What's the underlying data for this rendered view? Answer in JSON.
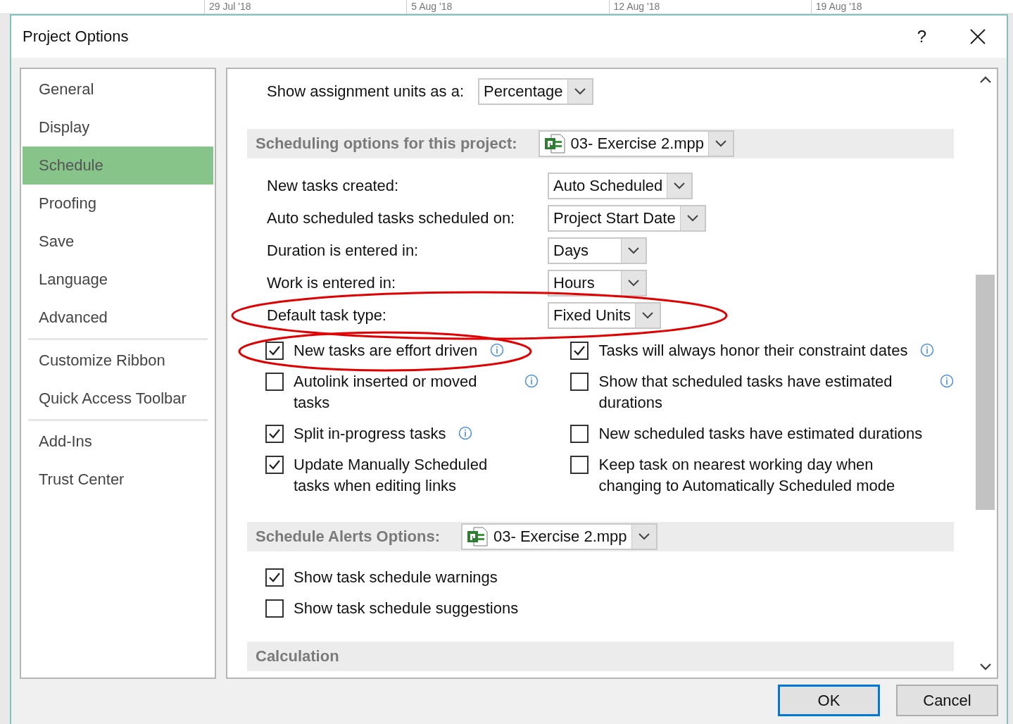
{
  "timeline": {
    "dates": [
      "29 Jul '18",
      "5 Aug '18",
      "12 Aug '18",
      "19 Aug '18"
    ]
  },
  "dialog": {
    "title": "Project Options",
    "help": "?"
  },
  "nav": {
    "groups": [
      [
        {
          "label": "General",
          "selected": false
        },
        {
          "label": "Display",
          "selected": false
        },
        {
          "label": "Schedule",
          "selected": true
        },
        {
          "label": "Proofing",
          "selected": false
        },
        {
          "label": "Save",
          "selected": false
        },
        {
          "label": "Language",
          "selected": false
        },
        {
          "label": "Advanced",
          "selected": false
        }
      ],
      [
        {
          "label": "Customize Ribbon",
          "selected": false
        },
        {
          "label": "Quick Access Toolbar",
          "selected": false
        }
      ],
      [
        {
          "label": "Add-Ins",
          "selected": false
        },
        {
          "label": "Trust Center",
          "selected": false
        }
      ]
    ]
  },
  "assignment_units": {
    "label": "Show assignment units as a:",
    "value": "Percentage"
  },
  "scheduling": {
    "heading": "Scheduling options for this project:",
    "project": "03- Exercise 2.mpp",
    "fields": [
      {
        "label": "New tasks created:",
        "value": "Auto Scheduled",
        "highlighted": false
      },
      {
        "label": "Auto scheduled tasks scheduled on:",
        "value": "Project Start Date",
        "highlighted": false
      },
      {
        "label": "Duration is entered in:",
        "value": "Days",
        "highlighted": false
      },
      {
        "label": "Work is entered in:",
        "value": "Hours",
        "highlighted": false
      },
      {
        "label": "Default task type:",
        "value": "Fixed Units",
        "highlighted": true
      }
    ],
    "options_left": [
      {
        "label": "New tasks are effort driven",
        "checked": true,
        "info": true,
        "highlighted": true
      },
      {
        "label": "Autolink inserted or moved tasks",
        "checked": false,
        "info": true,
        "highlighted": false
      },
      {
        "label": "Split in-progress tasks",
        "checked": true,
        "info": true,
        "highlighted": false
      },
      {
        "label": "Update Manually Scheduled tasks when editing links",
        "checked": true,
        "info": false,
        "highlighted": false
      }
    ],
    "options_right": [
      {
        "label": "Tasks will always honor their constraint dates",
        "checked": true,
        "info": true,
        "highlighted": false
      },
      {
        "label": "Show that scheduled tasks have estimated durations",
        "checked": false,
        "info": true,
        "highlighted": false
      },
      {
        "label": "New scheduled tasks have estimated durations",
        "checked": false,
        "info": false,
        "highlighted": false
      },
      {
        "label": "Keep task on nearest working day when changing to Automatically Scheduled mode",
        "checked": false,
        "info": false,
        "highlighted": false
      }
    ]
  },
  "alerts": {
    "heading": "Schedule Alerts Options:",
    "project": "03- Exercise 2.mpp",
    "options": [
      {
        "label": "Show task schedule warnings",
        "checked": true
      },
      {
        "label": "Show task schedule suggestions",
        "checked": false
      }
    ]
  },
  "calculation": {
    "heading": "Calculation"
  },
  "buttons": [
    {
      "label": "OK",
      "default": true
    },
    {
      "label": "Cancel",
      "default": false
    }
  ]
}
